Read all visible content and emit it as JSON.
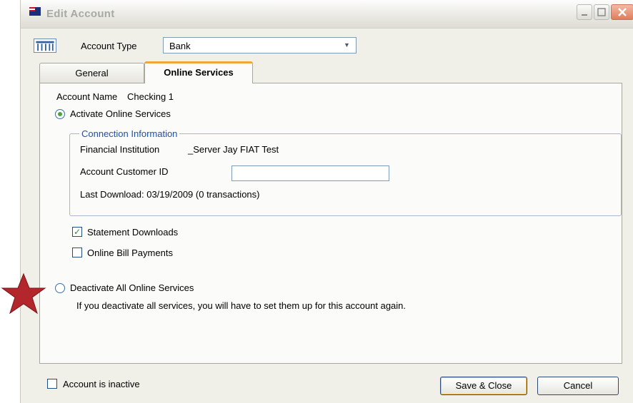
{
  "window": {
    "title": "Edit Account"
  },
  "account_type": {
    "label": "Account Type",
    "value": "Bank"
  },
  "tabs": [
    {
      "label": "General",
      "active": false
    },
    {
      "label": "Online Services",
      "active": true
    }
  ],
  "online_services": {
    "account_name_label": "Account Name",
    "account_name_value": "Checking 1",
    "activate_label": "Activate Online Services",
    "activate_selected": true,
    "connection": {
      "title": "Connection Information",
      "institution_label": "Financial Institution",
      "institution_value": "_Server Jay FIAT Test",
      "customer_id_label": "Account Customer ID",
      "customer_id_value": "",
      "last_download": "Last Download: 03/19/2009 (0 transactions)"
    },
    "statement_downloads_label": "Statement Downloads",
    "statement_downloads_checked": true,
    "bill_payments_label": "Online Bill Payments",
    "bill_payments_checked": false,
    "deactivate_label": "Deactivate All Online Services",
    "deactivate_selected": false,
    "deactivate_note": "If you deactivate all services, you will have to set them up for this account again."
  },
  "footer": {
    "inactive_label": "Account is inactive",
    "inactive_checked": false,
    "save_label": "Save & Close",
    "cancel_label": "Cancel"
  },
  "colors": {
    "tab_accent": "#f2a33a",
    "group_title": "#2150a8",
    "annotation_star": "#b3262b"
  }
}
